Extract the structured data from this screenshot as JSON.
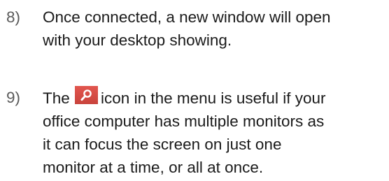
{
  "steps": [
    {
      "number": "8)",
      "lines": [
        "Once connected, a new window will open",
        "with your desktop showing."
      ]
    },
    {
      "number": "9)",
      "line1_before_icon": "The",
      "icon": "magnifier-icon",
      "line1_after_icon": "icon in the menu is useful if your",
      "lines": [
        "office computer has multiple monitors as",
        "it can focus the screen on just one",
        "monitor at a time, or all at once."
      ]
    }
  ],
  "colors": {
    "icon_background": "#d9534f",
    "number_text": "#5a5a5a",
    "body_text": "#1a1a1a"
  }
}
